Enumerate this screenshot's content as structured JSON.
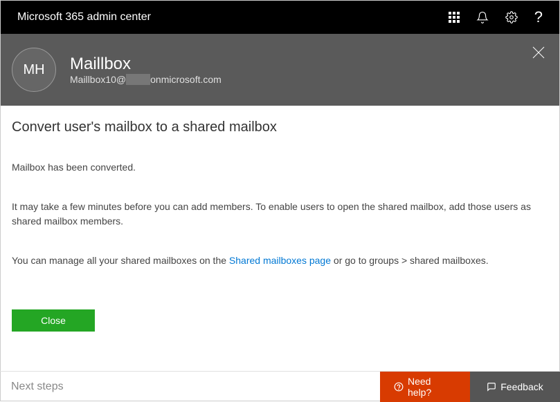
{
  "topbar": {
    "title": "Microsoft 365 admin center"
  },
  "panel": {
    "avatar_initials": "MH",
    "title": "Maillbox",
    "subtitle_prefix": "Maillbox10@",
    "subtitle_suffix": "onmicrosoft.com"
  },
  "content": {
    "heading": "Convert user's mailbox to a shared mailbox",
    "status": "Mailbox has been converted.",
    "info": "It may take a few minutes before you can add members. To enable users to open the shared mailbox, add those users as shared mailbox members.",
    "manage_prefix": "You can manage all your shared mailboxes on the ",
    "manage_link": "Shared mailboxes page",
    "manage_suffix": " or go to groups > shared mailboxes.",
    "close_label": "Close"
  },
  "footer": {
    "next_steps": "Next steps",
    "need_help": "Need help?",
    "feedback": "Feedback"
  }
}
